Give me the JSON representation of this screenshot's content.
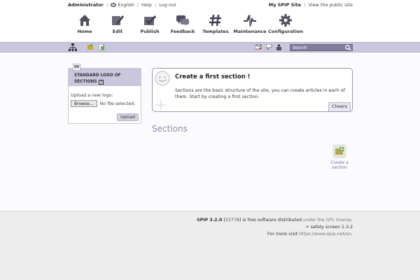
{
  "topbar": {
    "user": "Administrator",
    "language": "English",
    "help": "Help",
    "logout": "Log out",
    "site_name": "My SPIP Site",
    "view_public": "View the public site"
  },
  "nav": {
    "items": [
      {
        "label": "Home",
        "icon": "home-icon"
      },
      {
        "label": "Edit",
        "icon": "pencil-icon"
      },
      {
        "label": "Publish",
        "icon": "check-icon"
      },
      {
        "label": "Feedback",
        "icon": "speech-bubbles-icon"
      },
      {
        "label": "Templates",
        "icon": "hash-icon"
      },
      {
        "label": "Maintenance",
        "icon": "pulse-icon"
      },
      {
        "label": "Configuration",
        "icon": "gear-icon"
      }
    ]
  },
  "toolbar": {
    "search_placeholder": "Search"
  },
  "logo_box": {
    "title": "STANDARD LOGO OF SECTIONS",
    "help_mark": "?",
    "upload_label": "Upload a new logo:",
    "browse_label": "Browse...",
    "no_file": "No file selected.",
    "upload_button": "Upload"
  },
  "intro": {
    "title": "Create a first section !",
    "text": "Sections are the basic structure of the site, you can create articles in each of them. Start by creating a first section.",
    "cheers": "Cheers"
  },
  "sections": {
    "title": "Sections",
    "create_label": "Create a section"
  },
  "footer": {
    "product": "SPIP 3.2.0",
    "build_open": "[",
    "build": "23778",
    "build_close": "]",
    "free_text": "is free software distributed",
    "license_link": "under the GPL license",
    "period": ".",
    "safety": "+ safety screen 1.3.2",
    "visit_text": "For more visit",
    "visit_link": "https://www.spip.net/en",
    "visit_end": "."
  },
  "colors": {
    "accent": "#cac6dd",
    "search_bg": "#827d9a",
    "heading": "#8f8aa8"
  }
}
